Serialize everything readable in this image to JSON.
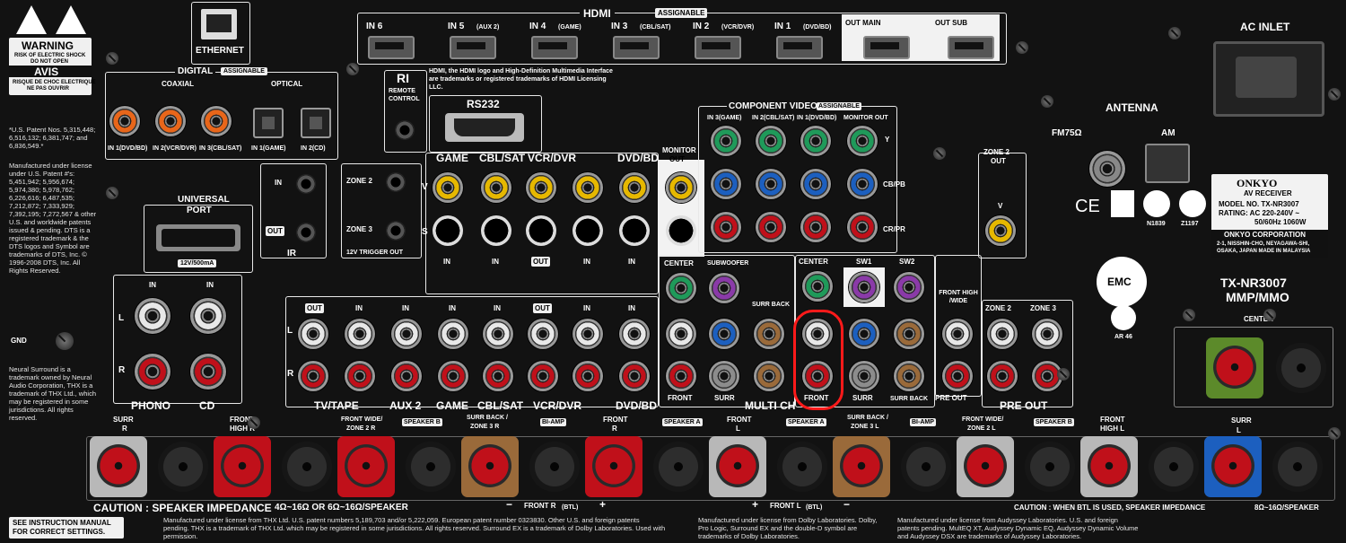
{
  "panel": {
    "warning": {
      "title": "WARNING",
      "line1": "RISK OF ELECTRIC SHOCK",
      "line2": "DO NOT OPEN",
      "avis": "AVIS",
      "avis1": "RISQUE DE CHOC ELECTRIQUE",
      "avis2": "NE PAS OUVRIR"
    },
    "ethernet": "ETHERNET",
    "hdmi": {
      "title": "HDMI",
      "assignable": "ASSIGNABLE",
      "ports": [
        {
          "name": "IN 6",
          "sub": ""
        },
        {
          "name": "IN 5",
          "sub": "(AUX 2)"
        },
        {
          "name": "IN 4",
          "sub": "(GAME)"
        },
        {
          "name": "IN 3",
          "sub": "(CBL/SAT)"
        },
        {
          "name": "IN 2",
          "sub": "(VCR/DVR)"
        },
        {
          "name": "IN 1",
          "sub": "(DVD/BD)"
        }
      ],
      "out_main": "OUT MAIN",
      "out_sub": "OUT SUB",
      "trademark": "HDMI, the HDMI logo and High-Definition Multimedia Interface are trademarks or registered trademarks of HDMI Licensing LLC."
    },
    "ac_inlet": "AC INLET",
    "digital": {
      "title": "DIGITAL",
      "assignable": "ASSIGNABLE",
      "coaxial": "COAXIAL",
      "optical": "OPTICAL",
      "coax_ports": [
        "IN 1(DVD/BD)",
        "IN 2(VCR/DVR)",
        "IN 3(CBL/SAT)"
      ],
      "optical_ports": [
        "IN 1(GAME)",
        "IN 2(CD)"
      ]
    },
    "ri": {
      "logo": "RI",
      "label1": "REMOTE",
      "label2": "CONTROL"
    },
    "rs232": "RS232",
    "patents": "*U.S. Patent Nos. 5,315,448; 6,516,132; 6,381,747; and 6,836,549.*",
    "dts_note": "Manufactured under license under U.S. Patent #'s: 5,451,942; 5,956,674; 5,974,380; 5,978,762; 6,226,616; 6,487,535; 7,212,872; 7,333,929; 7,392,195; 7,272,567 & other U.S. and worldwide patents issued & pending. DTS is a registered trademark & the DTS logos and Symbol are trademarks of DTS, Inc. © 1996-2008 DTS, Inc. All Rights Reserved.",
    "neural_note": "Neural Surround is a trademark owned by Neural Audio Corporation, THX is a trademark of THX Ltd., which may be registered in some jurisdictions. All rights reserved.",
    "universal_port": {
      "title": "UNIVERSAL",
      "title2": "PORT",
      "rating": "12V/500mA"
    },
    "ir": {
      "in": "IN",
      "out": "OUT",
      "label": "IR"
    },
    "zone_trigger": {
      "zone2": "ZONE 2",
      "zone3": "ZONE 3",
      "label": "12V TRIGGER OUT"
    },
    "video_inputs": {
      "sources": [
        "GAME",
        "CBL/SAT",
        "VCR/DVR",
        "DVD/BD"
      ],
      "v": "V",
      "s": "S",
      "in": "IN",
      "out": "OUT",
      "monitor_out": "MONITOR",
      "monitor_out2": "OUT"
    },
    "component": {
      "title": "COMPONENT VIDEO",
      "assignable": "ASSIGNABLE",
      "cols": [
        "IN 3(GAME)",
        "IN 2(CBL/SAT)",
        "IN 1(DVD/BD)",
        "MONITOR OUT"
      ],
      "rows": [
        "Y",
        "CB/PB",
        "CR/PR"
      ]
    },
    "zone2_out": {
      "line1": "ZONE 2",
      "line2": "OUT",
      "v": "V"
    },
    "antenna": {
      "title": "ANTENNA",
      "fm": "FM75Ω",
      "am": "AM"
    },
    "certs": {
      "ce": "CE",
      "n": "N1839",
      "z": "Z1197",
      "emc": "EMC",
      "pct": "AR 46"
    },
    "rating_plate": {
      "brand": "ONKYO",
      "product": "AV RECEIVER",
      "model": "MODEL NO. TX-NR3007",
      "rating": "RATING: AC 220-240V ~",
      "rating2": "50/60Hz  1060W",
      "corp": "ONKYO CORPORATION",
      "addr1": "2-1, NISSHIN-CHO, NEYAGAWA-SHI,",
      "addr2": "OSAKA, JAPAN     MADE IN MALAYSIA"
    },
    "model_title": "TX-NR3007",
    "model_sub": "MMP/MMO",
    "audio": {
      "phono": "PHONO",
      "cd": "CD",
      "gnd": "GND",
      "in": "IN",
      "out": "OUT",
      "l": "L",
      "r": "R",
      "groups": [
        "TV/TAPE",
        "AUX 2",
        "GAME",
        "CBL/SAT",
        "VCR/DVR",
        "DVD/BD"
      ],
      "multi_ch": "MULTI CH",
      "center": "CENTER",
      "subwoofer": "SUBWOOFER",
      "front": "FRONT",
      "surr": "SURR",
      "surr_back": "SURR BACK",
      "pre_center": "CENTER",
      "sw1": "SW1",
      "sw2": "SW2",
      "pre_front": "FRONT",
      "pre_surr": "SURR",
      "pre_surr_back": "SURR BACK",
      "front_high": "FRONT HIGH /WIDE",
      "zone2": "ZONE 2",
      "zone3": "ZONE 3",
      "pre_out": "PRE OUT",
      "pre_out2": "PRE OUT"
    },
    "speakers": {
      "labels": [
        {
          "t": "SURR",
          "s": "R"
        },
        {
          "t": "FRONT",
          "s": "HIGH R"
        },
        {
          "t": "FRONT WIDE/",
          "s": "ZONE 2 R"
        },
        {
          "t": "SURR BACK /",
          "s": "ZONE 3 R"
        },
        {
          "t": "FRONT",
          "s": "R"
        },
        {
          "t": "FRONT",
          "s": "L"
        },
        {
          "t": "SURR BACK /",
          "s": "ZONE 3 L"
        },
        {
          "t": "FRONT WIDE/",
          "s": "ZONE 2 L"
        },
        {
          "t": "FRONT",
          "s": "HIGH L"
        }
      ],
      "speaker_b": "SPEAKER B",
      "bi_amp": "BI-AMP",
      "speaker_a": "SPEAKER A",
      "front_r_btl": "FRONT R",
      "front_l_btl": "FRONT L",
      "btl": "(BTL)",
      "center": "CENTER",
      "surr_l": "SURR",
      "surr_l2": "L",
      "plus": "+",
      "minus": "−"
    },
    "caution_left": "CAUTION : SPEAKER IMPEDANCE",
    "caution_left_val": "4Ω~16Ω OR 6Ω~16Ω/SPEAKER",
    "caution_right": "CAUTION : WHEN BTL IS USED, SPEAKER IMPEDANCE",
    "caution_right_val": "8Ω~16Ω/SPEAKER",
    "see_manual": "SEE INSTRUCTION MANUAL",
    "see_manual2": "FOR CORRECT SETTINGS.",
    "footer_thx": "Manufactured under license from THX Ltd. U.S. patent numbers 5,189,703 and/or 5,222,059. European patent number 0323830. Other U.S. and foreign patents pending. THX is a trademark of THX Ltd. which may be registered in some jurisdictions. All rights reserved. Surround EX is a trademark of Dolby Laboratories. Used with permission.",
    "footer_dolby": "Manufactured under license from Dolby Laboratories. Dolby, Pro Logic, Surround EX and the double-D symbol are trademarks of Dolby Laboratories.",
    "footer_audyssey": "Manufactured under license from Audyssey Laboratories. U.S. and foreign patents pending. MultEQ XT, Audyssey Dynamic EQ, Audyssey Dynamic Volume and Audyssey DSX are trademarks of Audyssey Laboratories."
  },
  "colors": {
    "panel": "#121212",
    "text": "#ffffff",
    "red_jack": "#c0101a",
    "white_jack": "#e8e8e8",
    "yellow_jack": "#e6b800",
    "green_jack": "#1f9a5a",
    "blue_jack": "#1c5fbf",
    "purple_jack": "#8a3aa8",
    "gray_jack": "#8c8c8c",
    "brown_jack": "#9a6a3a",
    "orange_jack": "#e8661a",
    "highlight": "#ff1a1a"
  }
}
